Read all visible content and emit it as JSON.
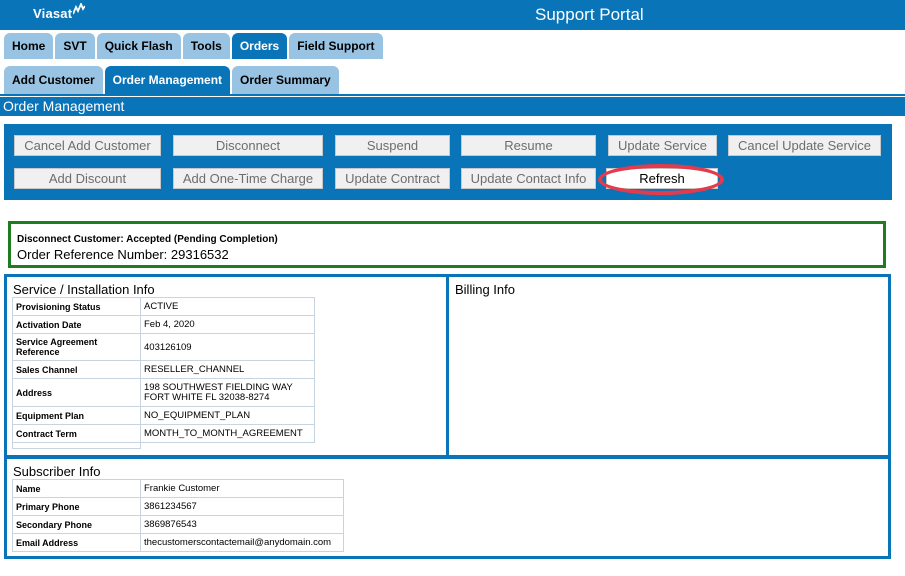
{
  "header": {
    "logo": "Viasat",
    "title": "Support Portal"
  },
  "main_tabs": [
    "Home",
    "SVT",
    "Quick Flash",
    "Tools",
    "Orders",
    "Field Support"
  ],
  "sub_tabs": [
    "Add Customer",
    "Order Management",
    "Order Summary"
  ],
  "section_title": "Order Management",
  "actions": {
    "cancel_add_customer": "Cancel Add Customer",
    "disconnect": "Disconnect",
    "suspend": "Suspend",
    "resume": "Resume",
    "update_service": "Update Service",
    "cancel_update_service": "Cancel Update Service",
    "add_discount": "Add Discount",
    "add_one_time_charge": "Add One-Time Charge",
    "update_contract": "Update Contract",
    "update_contact_info": "Update Contact Info",
    "refresh": "Refresh"
  },
  "status": {
    "message": "Disconnect Customer: Accepted (Pending Completion)",
    "order_reference": "Order Reference Number: 29316532"
  },
  "service_info": {
    "title": "Service / Installation Info",
    "rows": [
      {
        "label": "Provisioning Status",
        "value": "ACTIVE"
      },
      {
        "label": "Activation Date",
        "value": "Feb 4, 2020"
      },
      {
        "label": "Service Agreement Reference",
        "value": "403126109"
      },
      {
        "label": "Sales Channel",
        "value": "RESELLER_CHANNEL"
      },
      {
        "label": "Address",
        "value": "198 SOUTHWEST FIELDING WAY",
        "value2": "FORT WHITE FL 32038-8274"
      },
      {
        "label": "Equipment Plan",
        "value": "NO_EQUIPMENT_PLAN"
      },
      {
        "label": "Contract Term",
        "value": "MONTH_TO_MONTH_AGREEMENT"
      }
    ]
  },
  "billing_info": {
    "title": "Billing Info"
  },
  "subscriber_info": {
    "title": "Subscriber Info",
    "rows": [
      {
        "label": "Name",
        "value": "Frankie Customer"
      },
      {
        "label": "Primary Phone",
        "value": "3861234567"
      },
      {
        "label": "Secondary Phone",
        "value": "3869876543"
      },
      {
        "label": "Email Address",
        "value": "thecustomerscontactemail@anydomain.com"
      }
    ]
  }
}
